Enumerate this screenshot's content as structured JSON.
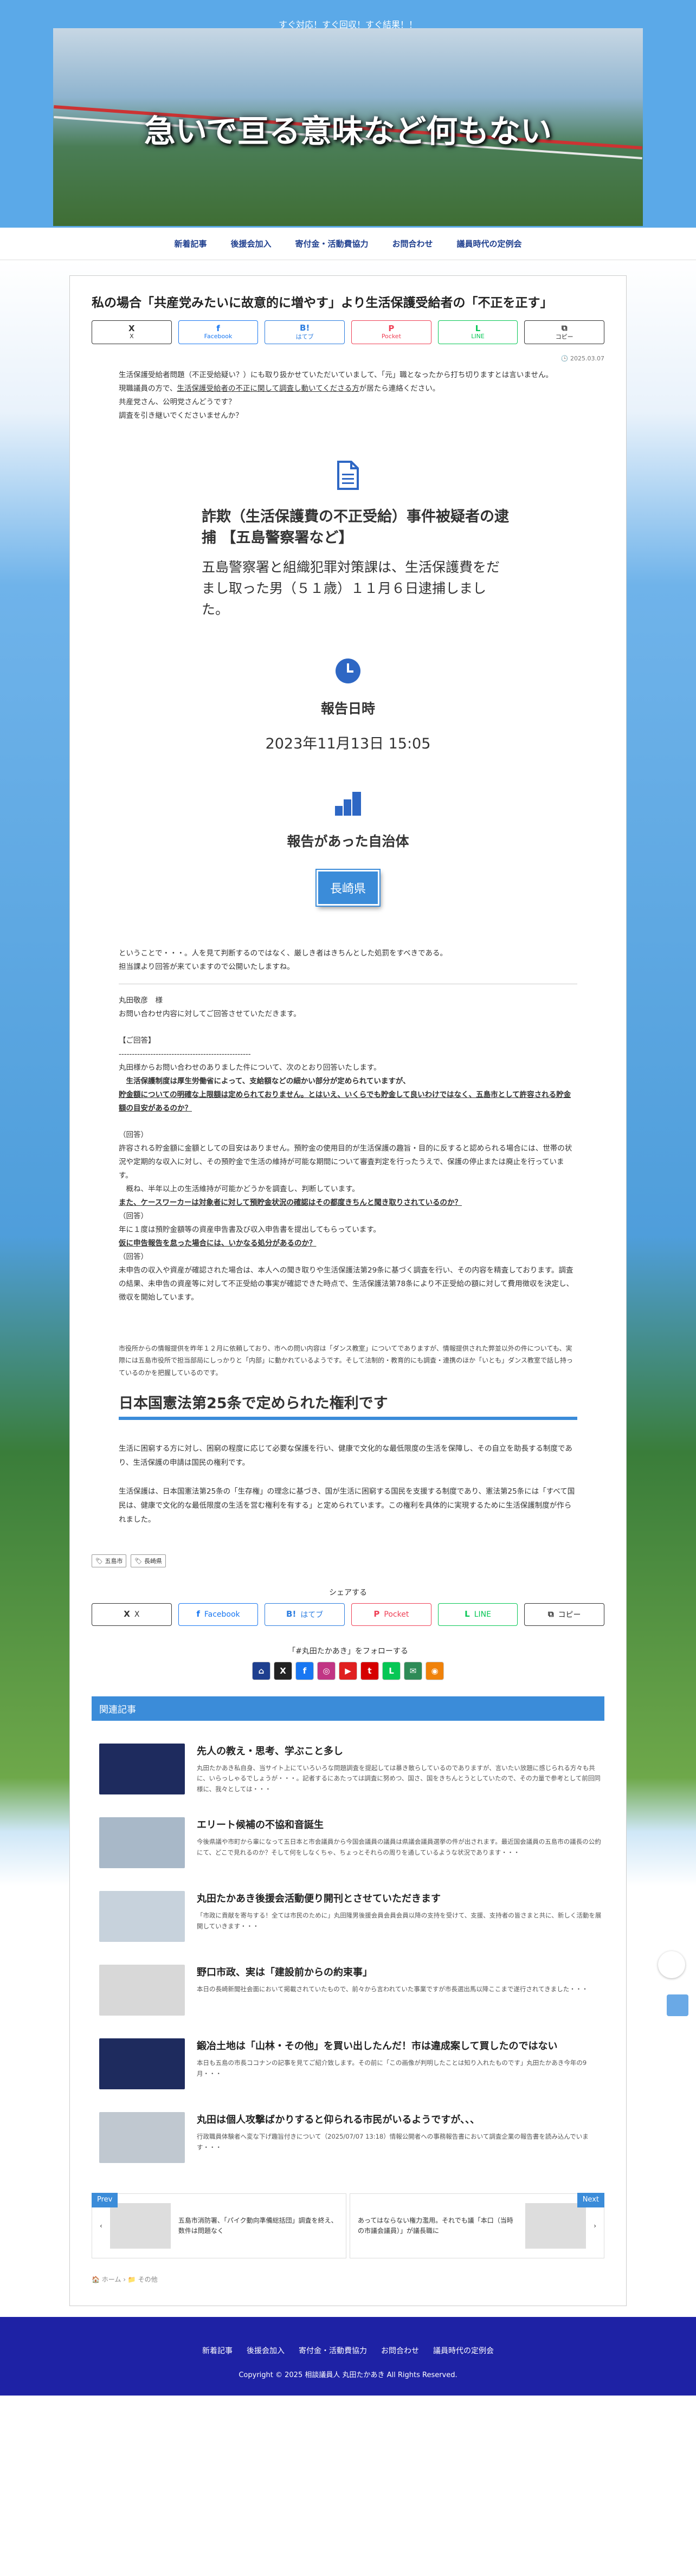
{
  "site": {
    "tagline": "すぐ対応！すぐ回収！すぐ結果！！",
    "title": "急いで亘る意味など何もない"
  },
  "nav": {
    "items": [
      "新着記事",
      "後援会加入",
      "寄付金・活動費協力",
      "お問合わせ",
      "議員時代の定例会"
    ]
  },
  "post": {
    "title": "私の場合「共産党みたいに故意的に増やす」より生活保護受給者の「不正を正す」",
    "date": "2025.03.07",
    "intro": [
      "生活保護受給者問題（不正受給疑い？）にも取り扱かせていただいていまして、「元」職となったから打ち切りますとは言いません。",
      "現職議員の方で、生活保護受給者の不正に関して調査し動いてくださる方が居たら連絡ください。",
      "共産党さん、公明党さんどうです？",
      "調査を引き継いでくださいませんか？"
    ],
    "intro_link": "生活保護受給者の不正に関して調査し動いてくださる方",
    "incident_heading": "詐欺（生活保護費の不正受給）事件被疑者の逮捕 【五島警察署など】",
    "incident_text": "五島警察署と組織犯罪対策課は、生活保護費をだまし取った男（５１歳）１１月６日逮捕しました。",
    "report_date_heading": "報告日時",
    "report_date": "2023年11月13日 15:05",
    "municipality_heading": "報告があった自治体",
    "municipality": "長崎県",
    "note": [
      "ということで・・・。人を見て判断するのではなく、厳しき者はきちんとした処罰をすべきである。",
      "担当課より回答が来ていますので公開いたしますね。"
    ],
    "letter": [
      {
        "t": "丸田敬彦　様",
        "s": ""
      },
      {
        "t": "お問い合わせ内容に対してご回答させていただきます。",
        "s": ""
      },
      {
        "t": "",
        "s": "gap"
      },
      {
        "t": "【ご回答】",
        "s": ""
      },
      {
        "t": "--------------------------------------------------",
        "s": ""
      },
      {
        "t": "丸田様からお問い合わせのありました件について、次のとおり回答いたします。",
        "s": ""
      },
      {
        "t": "　生活保護制度は厚生労働省によって、支給額などの細かい部分が定められていますが、",
        "s": "b"
      },
      {
        "t": "貯金額についての明確な上限額は定められておりません。とはいえ、いくらでも貯金して良いわけではなく、五島市として許容される貯金額の目安があるのか？",
        "s": "bu"
      },
      {
        "t": "",
        "s": "gap"
      },
      {
        "t": "（回答）",
        "s": ""
      },
      {
        "t": "許容される貯金額に金額としての目安はありません。預貯金の使用目的が生活保護の趣旨・目的に反すると認められる場合には、世帯の状況や定期的な収入に対し、その預貯金で生活の維持が可能な期間について審査判定を行ったうえで、保護の停止または廃止を行っています。",
        "s": ""
      },
      {
        "t": "　概ね、半年以上の生活維持が可能かどうかを調査し、判断しています。",
        "s": ""
      },
      {
        "t": "また、ケースワーカーは対象者に対して預貯金状況の確認はその都度きちんと聞き取りされているのか？",
        "s": "bu"
      },
      {
        "t": "（回答）",
        "s": ""
      },
      {
        "t": "年に１度は預貯金額等の資産申告書及び収入申告書を提出してもらっています。",
        "s": ""
      },
      {
        "t": "仮に申告報告を怠った場合には、いかなる処分があるのか？",
        "s": "bu"
      },
      {
        "t": "（回答）",
        "s": ""
      },
      {
        "t": "未申告の収入や資産が確認された場合は、本人への聞き取りや生活保護法第29条に基づく調査を行い、その内容を精査しております。調査の結果、未申告の資産等に対して不正受給の事実が確認できた時点で、生活保護法第78条により不正受給の額に対して費用徴収を決定し、徴収を開始しています。",
        "s": ""
      }
    ],
    "small_note": "市役所からの情報提供を昨年１２月に依頼しており、市への問い内容は「ダンス教室」についてでありますが、情報提供された弊並以外の件についても、実際には五島市役所で担当部局にしっかりと「内部」に動かれているようです。そして法制的・教育的にも調査・連携のほか「いとも」ダンス教室で話し持っているのかを把握しているのです。",
    "art25_heading": "日本国憲法第25条で定められた権利です",
    "art25": [
      "生活に困窮する方に対し、困窮の程度に応じて必要な保護を行い、健康で文化的な最低限度の生活を保障し、その自立を助長する制度であり、生活保護の申請は国民の権利です。",
      "生活保護は、日本国憲法第25条の「生存権」の理念に基づき、国が生活に困窮する国民を支援する制度であり、憲法第25条には「すべて国民は、健康で文化的な最低限度の生活を営む権利を有する」と定められています。この権利を具体的に実現するために生活保護制度が作られました。"
    ],
    "tags": [
      "五島市",
      "長崎県"
    ]
  },
  "share_top": [
    {
      "name": "x",
      "icon": "X",
      "label": "X",
      "color": "#333"
    },
    {
      "name": "facebook",
      "icon": "f",
      "label": "Facebook",
      "color": "#1877f2"
    },
    {
      "name": "hatena",
      "icon": "B!",
      "label": "はてブ",
      "color": "#2c7de0"
    },
    {
      "name": "pocket",
      "icon": "P",
      "label": "Pocket",
      "color": "#ef4056"
    },
    {
      "name": "line",
      "icon": "L",
      "label": "LINE",
      "color": "#06c755"
    },
    {
      "name": "copy",
      "icon": "⧉",
      "label": "コピー",
      "color": "#333"
    }
  ],
  "share_label": "シェアする",
  "follow_label": "「#丸田たかあき」をフォローする",
  "follow_icons": [
    {
      "icon": "⌂",
      "color": "#1e3f8f"
    },
    {
      "icon": "X",
      "color": "#222"
    },
    {
      "icon": "f",
      "color": "#1877f2"
    },
    {
      "icon": "◎",
      "color": "#c13584"
    },
    {
      "icon": "▶",
      "color": "#e02020"
    },
    {
      "icon": "t",
      "color": "#d60000"
    },
    {
      "icon": "L",
      "color": "#06c755"
    },
    {
      "icon": "✉",
      "color": "#2e8b57"
    },
    {
      "icon": "◉",
      "color": "#f0820a"
    }
  ],
  "related": {
    "heading": "関連記事",
    "items": [
      {
        "title": "先人の教え・思考、学ぶこと多し",
        "desc": "丸田たかあき私自身、当サイト上にていろいろな問題調査を提起しては暴き散らしているのでありますが、言いたい放題に感じられる方々も共に、いらっしゃるでしょうが・・・。記者するにあたっては調査に努めつ、国さ、国をきちんとうとしていたので、その力量で参考として前回同様に、我々としては・・・",
        "c": "#1e2b5e"
      },
      {
        "title": "エリート候補の不協和音誕生",
        "desc": "今後県議や市町から輩になって五日本と市会議員から今国会議員の議員は県議会議員選挙の件が出されます。最近国会議員の五島市の議長の公約にて、どこで見れるのか？そして何をしなくちゃ、ちょっとそれらの周りを通しているような状況であります・・・",
        "c": "#a8b8c8"
      },
      {
        "title": "丸田たかあき後援会活動便り開刊とさせていただきます",
        "desc": "「市政に貢献を寄与する！全ては市民のために」丸田隆男後援会員会員会員以降の支持を受けて、支援、支持者の皆さまと共に、新しく活動を展開していきます・・・",
        "c": "#c7d2dc"
      },
      {
        "title": "野口市政、実は「建設前からの約束事」",
        "desc": "本日の長崎新聞社会面において掲載されていたもので、前々から言われていた事業ですが市長選出馬以降ここまで遂行されてきました・・・",
        "c": "#d8d8d8"
      },
      {
        "title": "鍛冶土地は「山林・その他」を買い出したんだ！市は違成案して買したのではない",
        "desc": "本日も五島の市長ココナンの記事を見てご紹介致します。その前に「この画像が判明したことは知り入れたものです」丸田たかあき今年の9月・・・",
        "c": "#1e2b5e"
      },
      {
        "title": "丸田は個人攻撃ばかりすると仰られる市民がいるようですが、、、",
        "desc": "行政職員体験者へ変な下げ趣旨付きについて（2025/07/07 13:18）情報公開者への事務報告書において調査企業の報告書を読み込んでいます・・・",
        "c": "#c0c8d0"
      }
    ]
  },
  "prev_next": {
    "prev_label": "Prev",
    "prev_title": "五島市消防署、「パイク動向準備総括団」調査を終え、数件は問題なく",
    "next_label": "Next",
    "next_title": "あってはならない権力濫用。それでも議「本口（当時の市議会議員）」が議長職に"
  },
  "breadcrumbs": [
    "ホーム",
    "その他"
  ],
  "footer": {
    "nav": [
      "新着記事",
      "後援会加入",
      "寄付金・活動費協力",
      "お問合わせ",
      "議員時代の定例会"
    ],
    "copy": "Copyright © 2025 相談議員人 丸田たかあき All Rights Reserved."
  }
}
